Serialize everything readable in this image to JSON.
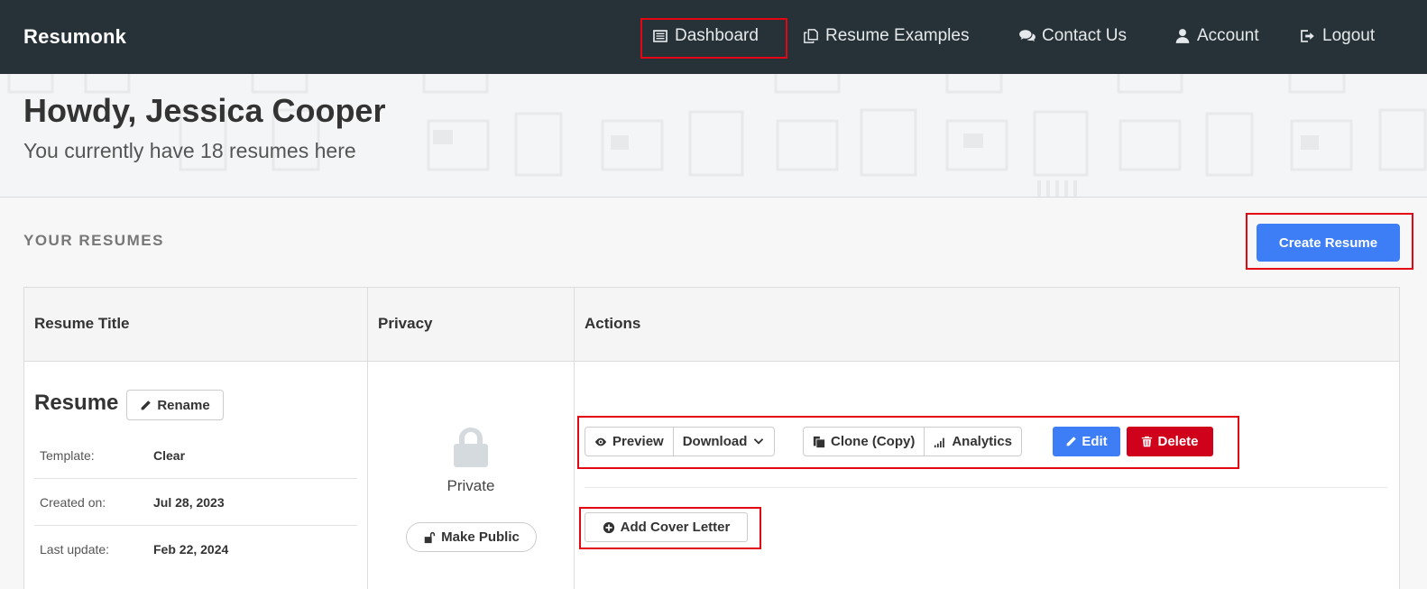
{
  "nav": {
    "brand": "Resumonk",
    "links": [
      {
        "label": "Dashboard",
        "icon": "list-alt-icon"
      },
      {
        "label": "Resume Examples",
        "icon": "copy-icon"
      },
      {
        "label": "Contact Us",
        "icon": "comments-icon"
      },
      {
        "label": "Account",
        "icon": "user-icon"
      },
      {
        "label": "Logout",
        "icon": "sign-out-icon"
      }
    ]
  },
  "hero": {
    "title": "Howdy, Jessica Cooper",
    "subtitle": "You currently have 18 resumes here"
  },
  "section": {
    "title": "YOUR RESUMES",
    "create_label": "Create Resume"
  },
  "table": {
    "headers": [
      "Resume Title",
      "Privacy",
      "Actions"
    ],
    "rows": [
      {
        "title": "Resume",
        "rename_label": "Rename",
        "meta": [
          {
            "label": "Template:",
            "value": "Clear"
          },
          {
            "label": "Created on:",
            "value": "Jul 28, 2023"
          },
          {
            "label": "Last update:",
            "value": "Feb 22, 2024"
          }
        ],
        "privacy": "Private",
        "make_public_label": "Make Public",
        "actions": {
          "preview": "Preview",
          "download": "Download",
          "clone": "Clone (Copy)",
          "analytics": "Analytics",
          "edit": "Edit",
          "delete": "Delete",
          "cover_letter": "Add Cover Letter"
        }
      }
    ]
  },
  "colors": {
    "navbar": "#263238",
    "primary": "#3d7ef6",
    "danger": "#d0021b",
    "highlight": "#e30613"
  }
}
